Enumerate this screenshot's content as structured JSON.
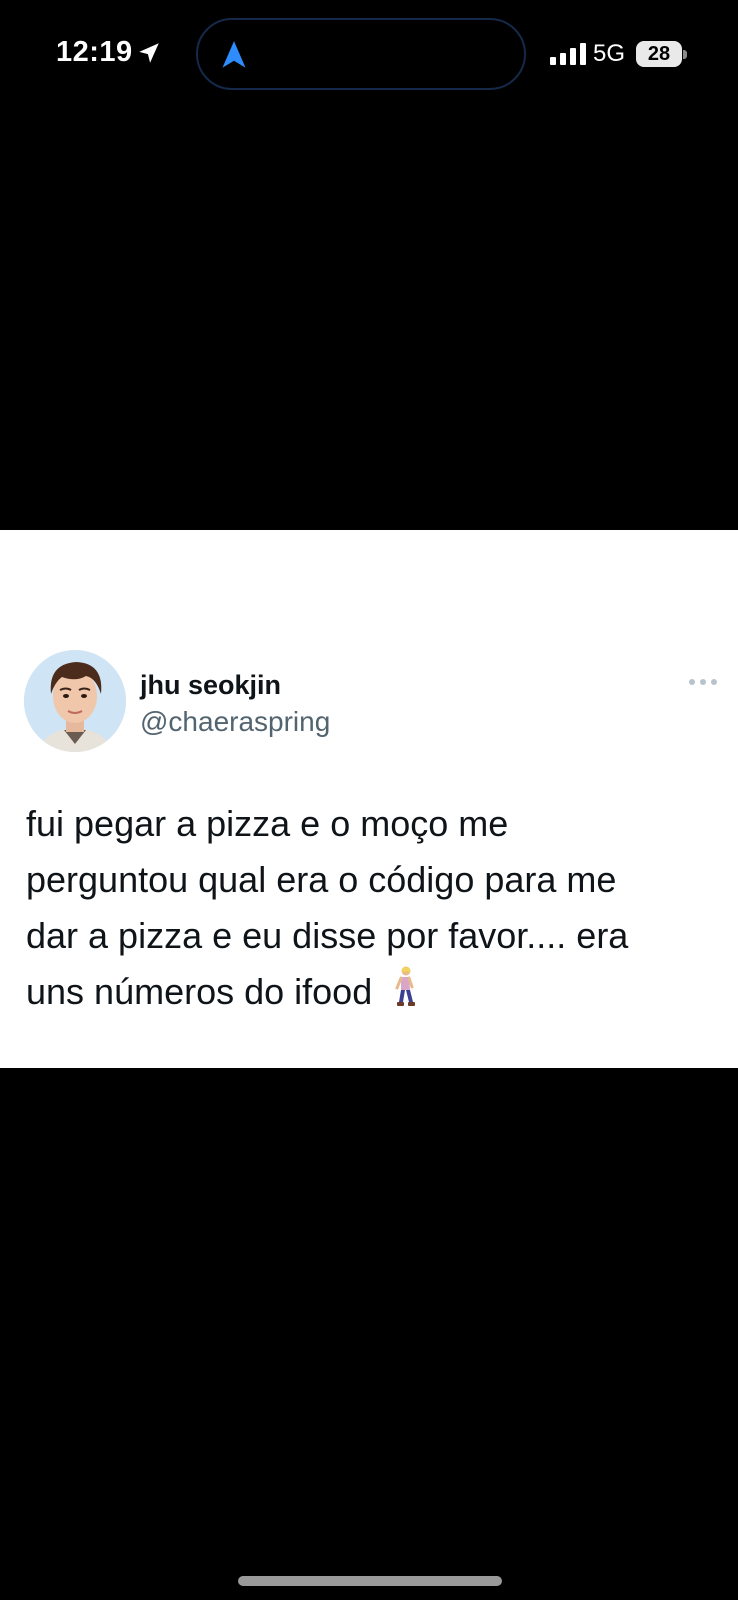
{
  "status_bar": {
    "time": "12:19",
    "network": "5G",
    "battery": "28",
    "location_icon": "location-arrow-icon",
    "navigation_icon": "navigation-arrow-icon",
    "signal_icon": "signal-bars-icon"
  },
  "tweet": {
    "author_name": "jhu seokjin",
    "author_handle": "@chaeraspring",
    "lines": [
      "fui pegar a pizza e o moço me",
      "perguntou qual era o código para me",
      "dar a pizza e eu disse por favor.... era",
      "uns números do ifood"
    ],
    "emoji_icon": "person-walking-icon",
    "more_icon": "more-options-icon"
  },
  "colors": {
    "background": "#000000",
    "card": "#ffffff",
    "text_primary": "#0f1419",
    "text_secondary": "#536471",
    "nav_accent": "#2f8cff"
  }
}
